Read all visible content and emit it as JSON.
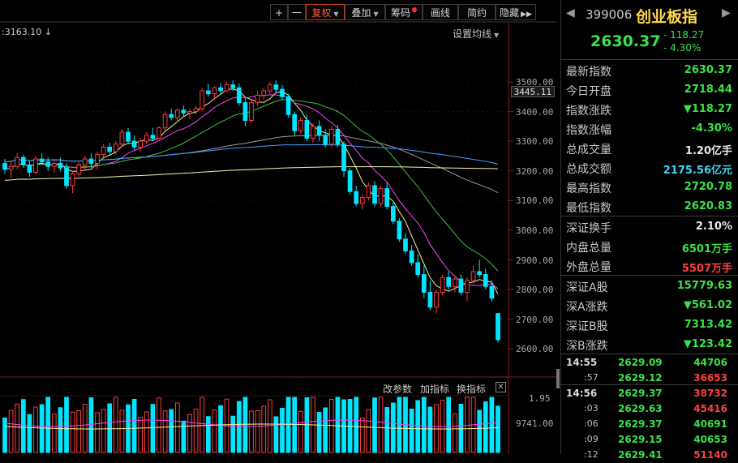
{
  "toolbar": {
    "plus": "+",
    "minus": "一",
    "fuquan": "复权",
    "diejia": "叠加",
    "choumao": "筹码",
    "huaxian": "画线",
    "jianyue": "简约",
    "yincang": "隐藏"
  },
  "chart": {
    "last_price_label": ":3163.10",
    "ma_settings": "设置均线",
    "current_price_tag": "3445.11",
    "y_ticks": [
      "3500.00",
      "3400.00",
      "3300.00",
      "3200.00",
      "3100.00",
      "3000.00",
      "2900.00",
      "2800.00",
      "2700.00",
      "2600.00"
    ],
    "sub_buttons": [
      "改参数",
      "加指标",
      "换指标"
    ],
    "sub_y_ticks": [
      "1.95",
      "9741.00"
    ]
  },
  "chart_data": {
    "type": "candlestick",
    "ylim": [
      2600,
      3500
    ],
    "candles_ohlc": [
      [
        3225,
        3240,
        3190,
        3205
      ],
      [
        3205,
        3230,
        3175,
        3215
      ],
      [
        3215,
        3260,
        3205,
        3245
      ],
      [
        3245,
        3255,
        3210,
        3220
      ],
      [
        3220,
        3235,
        3180,
        3195
      ],
      [
        3195,
        3250,
        3190,
        3240
      ],
      [
        3240,
        3260,
        3220,
        3230
      ],
      [
        3230,
        3245,
        3200,
        3215
      ],
      [
        3215,
        3240,
        3195,
        3225
      ],
      [
        3225,
        3245,
        3200,
        3210
      ],
      [
        3210,
        3225,
        3140,
        3150
      ],
      [
        3150,
        3200,
        3125,
        3190
      ],
      [
        3190,
        3230,
        3180,
        3220
      ],
      [
        3220,
        3250,
        3200,
        3240
      ],
      [
        3240,
        3260,
        3210,
        3225
      ],
      [
        3225,
        3265,
        3205,
        3255
      ],
      [
        3255,
        3290,
        3245,
        3280
      ],
      [
        3280,
        3295,
        3255,
        3265
      ],
      [
        3265,
        3300,
        3255,
        3290
      ],
      [
        3290,
        3340,
        3280,
        3330
      ],
      [
        3330,
        3345,
        3290,
        3300
      ],
      [
        3300,
        3320,
        3270,
        3280
      ],
      [
        3280,
        3310,
        3265,
        3300
      ],
      [
        3300,
        3330,
        3290,
        3320
      ],
      [
        3320,
        3345,
        3300,
        3310
      ],
      [
        3310,
        3350,
        3305,
        3345
      ],
      [
        3345,
        3400,
        3335,
        3390
      ],
      [
        3390,
        3410,
        3370,
        3380
      ],
      [
        3380,
        3410,
        3370,
        3405
      ],
      [
        3405,
        3420,
        3385,
        3395
      ],
      [
        3395,
        3410,
        3375,
        3400
      ],
      [
        3400,
        3420,
        3390,
        3410
      ],
      [
        3410,
        3480,
        3400,
        3470
      ],
      [
        3470,
        3495,
        3450,
        3460
      ],
      [
        3460,
        3485,
        3440,
        3480
      ],
      [
        3480,
        3495,
        3460,
        3470
      ],
      [
        3470,
        3500,
        3465,
        3490
      ],
      [
        3490,
        3505,
        3470,
        3480
      ],
      [
        3480,
        3495,
        3420,
        3430
      ],
      [
        3430,
        3450,
        3350,
        3370
      ],
      [
        3370,
        3440,
        3360,
        3430
      ],
      [
        3430,
        3470,
        3420,
        3455
      ],
      [
        3455,
        3480,
        3440,
        3470
      ],
      [
        3470,
        3500,
        3460,
        3490
      ],
      [
        3490,
        3505,
        3465,
        3475
      ],
      [
        3475,
        3490,
        3440,
        3450
      ],
      [
        3450,
        3460,
        3380,
        3390
      ],
      [
        3390,
        3400,
        3320,
        3335
      ],
      [
        3335,
        3380,
        3325,
        3370
      ],
      [
        3370,
        3390,
        3300,
        3310
      ],
      [
        3310,
        3360,
        3295,
        3350
      ],
      [
        3350,
        3370,
        3300,
        3320
      ],
      [
        3320,
        3340,
        3280,
        3290
      ],
      [
        3290,
        3350,
        3280,
        3340
      ],
      [
        3340,
        3355,
        3280,
        3290
      ],
      [
        3290,
        3300,
        3180,
        3200
      ],
      [
        3200,
        3210,
        3120,
        3130
      ],
      [
        3130,
        3150,
        3080,
        3090
      ],
      [
        3090,
        3120,
        3070,
        3110
      ],
      [
        3110,
        3160,
        3100,
        3150
      ],
      [
        3150,
        3165,
        3080,
        3090
      ],
      [
        3090,
        3150,
        3080,
        3140
      ],
      [
        3140,
        3160,
        3070,
        3080
      ],
      [
        3080,
        3100,
        3020,
        3030
      ],
      [
        3030,
        3040,
        2960,
        2970
      ],
      [
        2970,
        2990,
        2920,
        2930
      ],
      [
        2930,
        2950,
        2880,
        2890
      ],
      [
        2890,
        2920,
        2840,
        2850
      ],
      [
        2850,
        2880,
        2770,
        2790
      ],
      [
        2790,
        2830,
        2730,
        2740
      ],
      [
        2740,
        2800,
        2720,
        2790
      ],
      [
        2790,
        2850,
        2780,
        2840
      ],
      [
        2840,
        2860,
        2800,
        2810
      ],
      [
        2810,
        2845,
        2790,
        2835
      ],
      [
        2835,
        2850,
        2780,
        2790
      ],
      [
        2790,
        2840,
        2760,
        2830
      ],
      [
        2830,
        2880,
        2820,
        2860
      ],
      [
        2860,
        2900,
        2840,
        2850
      ],
      [
        2850,
        2870,
        2800,
        2810
      ],
      [
        2810,
        2830,
        2760,
        2770
      ],
      [
        2718.44,
        2720.78,
        2620.83,
        2630.37
      ]
    ],
    "series": [
      {
        "name": "MA5",
        "color": "#f0f0a0"
      },
      {
        "name": "MA10",
        "color": "#ff40ff"
      },
      {
        "name": "MA20",
        "color": "#40c040"
      },
      {
        "name": "MA30",
        "color": "#9a9a9a"
      },
      {
        "name": "MA60",
        "color": "#40a0ff"
      },
      {
        "name": "MA120",
        "color": "#f5f5b0"
      }
    ]
  },
  "quote": {
    "code": "399006",
    "name": "创业板指",
    "price": "2630.37",
    "change": "- 118.27",
    "change_pct": "- 4.30%",
    "stats": [
      {
        "label": "最新指数",
        "value": "2630.37",
        "color": "#3ce04a"
      },
      {
        "label": "今日开盘",
        "value": "2718.44",
        "color": "#3ce04a"
      },
      {
        "label": "指数涨跌",
        "value": "▼118.27",
        "color": "#3ce04a"
      },
      {
        "label": "指数涨幅",
        "value": "-4.30%",
        "color": "#3ce04a"
      },
      {
        "label": "总成交量",
        "value": "1.20亿手",
        "color": "#e8e8e8"
      },
      {
        "label": "总成交额",
        "value": "2175.56亿元",
        "color": "#40d8f0"
      },
      {
        "label": "最高指数",
        "value": "2720.78",
        "color": "#3ce04a"
      },
      {
        "label": "最低指数",
        "value": "2620.83",
        "color": "#3ce04a"
      },
      {
        "label": "深证换手",
        "value": "2.10%",
        "color": "#e8e8e8"
      },
      {
        "label": "内盘总量",
        "value": "6501万手",
        "color": "#3ce04a"
      },
      {
        "label": "外盘总量",
        "value": "5507万手",
        "color": "#ff4040"
      },
      {
        "label": "深证A股",
        "value": "15779.63",
        "color": "#3ce04a"
      },
      {
        "label": "深A涨跌",
        "value": "▼561.02",
        "color": "#3ce04a"
      },
      {
        "label": "深证B股",
        "value": "7313.42",
        "color": "#3ce04a"
      },
      {
        "label": "深B涨跌",
        "value": "▼123.42",
        "color": "#3ce04a"
      }
    ],
    "ticks": [
      {
        "time": "14:55",
        "price": "2629.09",
        "vol": "44706",
        "vol_color": "#3ce04a"
      },
      {
        "time": ":57",
        "price": "2629.12",
        "vol": "36653",
        "vol_color": "#ff4040"
      },
      {
        "time": "14:56",
        "price": "2629.37",
        "vol": "38732",
        "vol_color": "#ff4040"
      },
      {
        "time": ":03",
        "price": "2629.63",
        "vol": "45416",
        "vol_color": "#ff4040"
      },
      {
        "time": ":06",
        "price": "2629.37",
        "vol": "40691",
        "vol_color": "#3ce04a"
      },
      {
        "time": ":09",
        "price": "2629.15",
        "vol": "40653",
        "vol_color": "#3ce04a"
      },
      {
        "time": ":12",
        "price": "2629.41",
        "vol": "51140",
        "vol_color": "#ff4040"
      }
    ]
  }
}
